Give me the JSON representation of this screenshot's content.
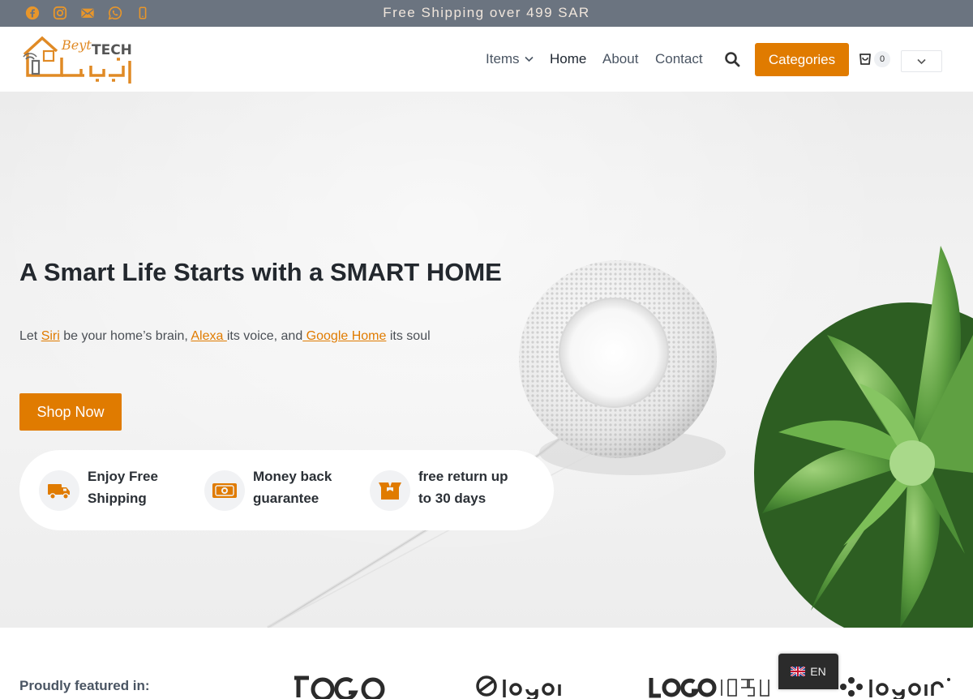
{
  "topbar": {
    "shipping_text": "Free Shipping over 499 SAR",
    "social_icons": [
      "facebook-icon",
      "instagram-icon",
      "mail-icon",
      "whatsapp-icon",
      "phone-icon"
    ],
    "icon_color": "#e8962a"
  },
  "header": {
    "logo_text_latin": "Beyt TECH",
    "nav": {
      "items_label": "Items",
      "home_label": "Home",
      "about_label": "About",
      "contact_label": "Contact"
    },
    "categories_label": "Categories",
    "cart_count": "0"
  },
  "hero": {
    "title": "A Smart Life Starts with a SMART HOME",
    "subtitle": {
      "part1": "Let ",
      "siri": "Siri",
      "part2": " be your home’s brain, ",
      "alexa": "Alexa ",
      "part3": "its voice, and",
      "google": " Google Home",
      "part4": " its soul"
    },
    "shop_label": "Shop Now",
    "features": [
      {
        "label": "Enjoy Free Shipping",
        "icon": "truck-icon"
      },
      {
        "label": "Money back guarantee",
        "icon": "money-icon"
      },
      {
        "label": "free return up to 30 days",
        "icon": "box-icon"
      }
    ]
  },
  "featured": {
    "label": "Proudly featured in:"
  },
  "language": {
    "current": "EN"
  },
  "colors": {
    "accent": "#e07b00",
    "topbar_bg": "#6b7480"
  }
}
